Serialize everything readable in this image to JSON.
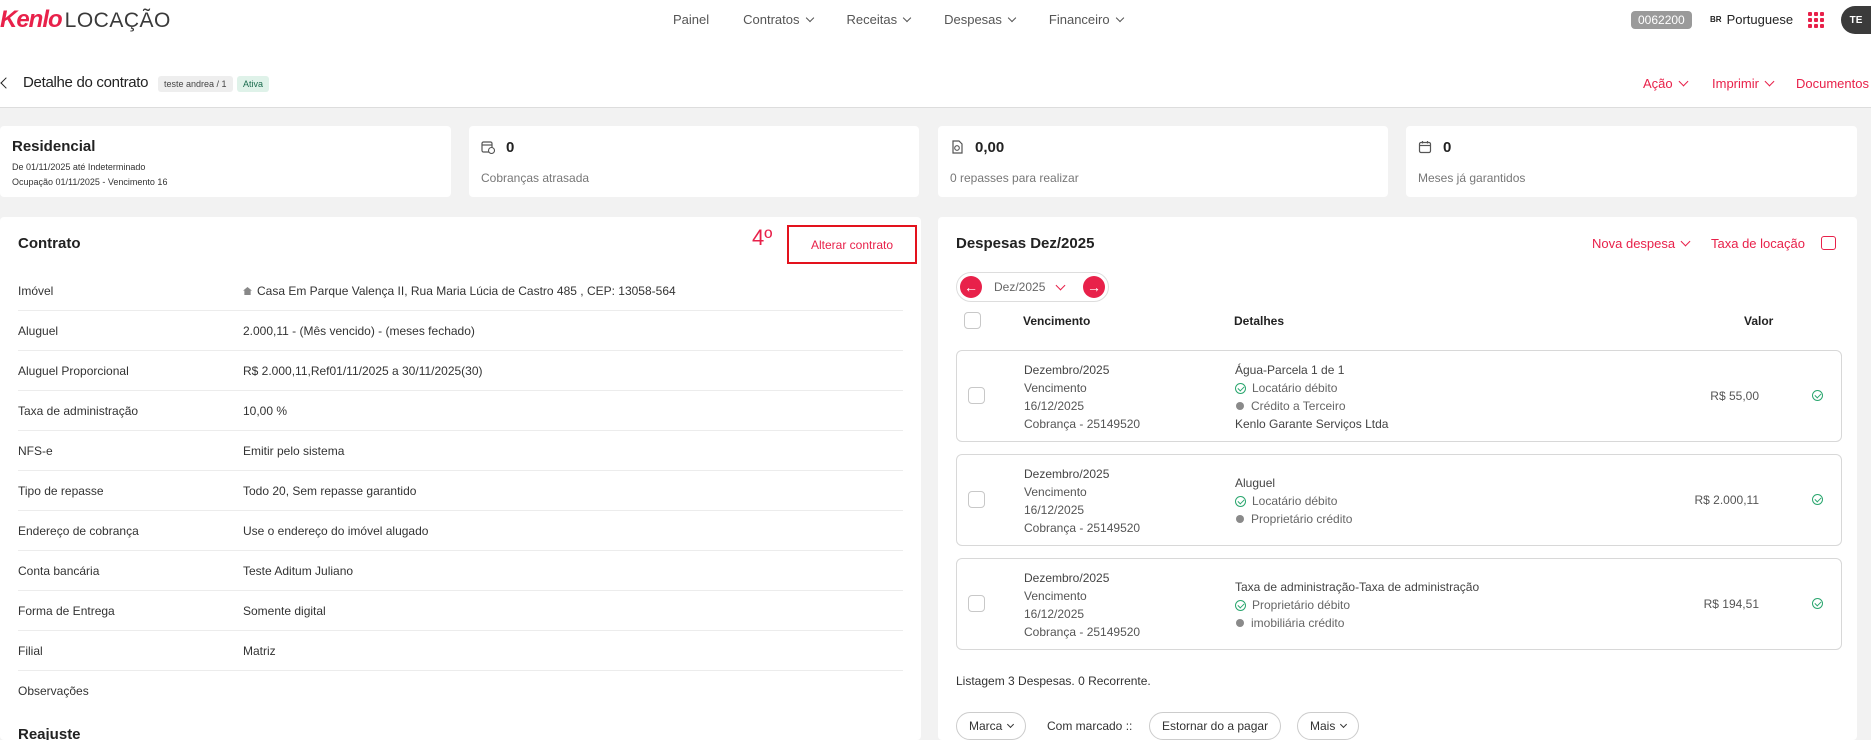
{
  "topbar": {
    "logo_kenlo": "Kenlo",
    "logo_product": "LOCAÇÃO",
    "nav": [
      {
        "label": "Painel",
        "has_menu": false
      },
      {
        "label": "Contratos",
        "has_menu": true
      },
      {
        "label": "Receitas",
        "has_menu": true
      },
      {
        "label": "Despesas",
        "has_menu": true
      },
      {
        "label": "Financeiro",
        "has_menu": true
      }
    ],
    "account_code": "0062200",
    "lang_flag": "BR",
    "lang_label": "Portuguese",
    "avatar_initials": "TE"
  },
  "header": {
    "title": "Detalhe do contrato",
    "tag": "teste andrea / 1",
    "status": "Ativa",
    "actions": {
      "acao": "Ação",
      "imprimir": "Imprimir",
      "documentos": "Documentos"
    }
  },
  "summary": {
    "residencial": {
      "title": "Residencial",
      "line1": "De 01/11/2025 até Indeterminado",
      "line2": "Ocupação 01/11/2025 - Vencimento 16"
    },
    "cobrancas": {
      "value": "0",
      "label": "Cobranças atrasada"
    },
    "repasses": {
      "value": "0,00",
      "label": "0 repasses para realizar"
    },
    "meses": {
      "value": "0",
      "label": "Meses já garantidos"
    }
  },
  "contract": {
    "title": "Contrato",
    "step": "4º",
    "alter_label": "Alterar contrato",
    "rows": [
      {
        "key": "Imóvel",
        "value": "Casa Em Parque Valença II, Rua Maria Lúcia de Castro 485 , CEP: 13058-564"
      },
      {
        "key": "Aluguel",
        "value": "2.000,11 - (Mês vencido) - (meses fechado)"
      },
      {
        "key": "Aluguel Proporcional",
        "value": "R$ 2.000,11,Ref01/11/2025 a 30/11/2025(30)"
      },
      {
        "key": "Taxa de administração",
        "value": "10,00 %"
      },
      {
        "key": "NFS-e",
        "value": "Emitir pelo sistema"
      },
      {
        "key": "Tipo de repasse",
        "value": "Todo 20, Sem repasse garantido"
      },
      {
        "key": "Endereço de cobrança",
        "value": "Use o endereço do imóvel alugado"
      },
      {
        "key": "Conta bancária",
        "value": "Teste Aditum Juliano"
      },
      {
        "key": "Forma de Entrega",
        "value": "Somente digital"
      },
      {
        "key": "Filial",
        "value": "Matriz"
      },
      {
        "key": "Observações",
        "value": ""
      }
    ],
    "reajuste_title": "Reajuste"
  },
  "expenses": {
    "title": "Despesas Dez/2025",
    "nova_despesa": "Nova despesa",
    "taxa_locacao": "Taxa de locação",
    "month": "Dez/2025",
    "headers": {
      "vencimento": "Vencimento",
      "detalhes": "Detalhes",
      "valor": "Valor"
    },
    "rows": [
      {
        "month": "Dezembro/2025",
        "venc_label": "Vencimento",
        "date": "16/12/2025",
        "cobranca": "Cobrança - 25149520",
        "title": "Água-Parcela 1 de 1",
        "status1": "Locatário débito",
        "status2": "Crédito a Terceiro",
        "extra": "Kenlo Garante Serviços Ltda",
        "value": "R$ 55,00"
      },
      {
        "month": "Dezembro/2025",
        "venc_label": "Vencimento",
        "date": "16/12/2025",
        "cobranca": "Cobrança - 25149520",
        "title": "Aluguel",
        "status1": "Locatário débito",
        "status2": "Proprietário crédito",
        "extra": "",
        "value": "R$ 2.000,11"
      },
      {
        "month": "Dezembro/2025",
        "venc_label": "Vencimento",
        "date": "16/12/2025",
        "cobranca": "Cobrança - 25149520",
        "title": "Taxa de administração-Taxa de administração",
        "status1": "Proprietário débito",
        "status2": "imobiliária crédito",
        "extra": "",
        "value": "R$ 194,51"
      }
    ],
    "listing": "Listagem 3 Despesas. 0 Recorrente.",
    "footer": {
      "marca": "Marca",
      "com_marcado": "Com marcado ::",
      "estornar": "Estornar do a pagar",
      "mais": "Mais"
    }
  },
  "colors": {
    "accent": "#e8214a",
    "success": "#2aa66e",
    "highlight_border": "#e3121d"
  }
}
